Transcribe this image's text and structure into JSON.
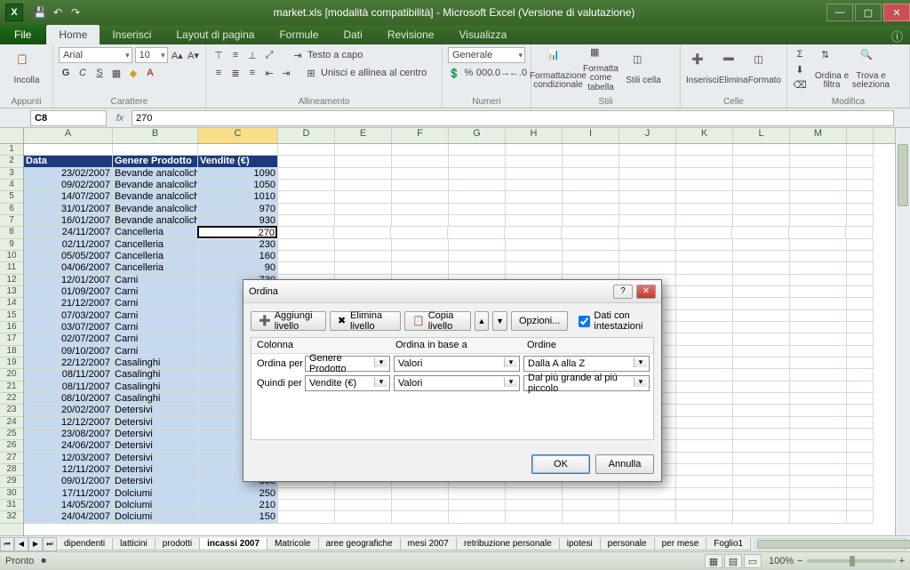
{
  "title": "market.xls  [modalità compatibilità] - Microsoft Excel (Versione di valutazione)",
  "tabs": {
    "file": "File",
    "items": [
      "Home",
      "Inserisci",
      "Layout di pagina",
      "Formule",
      "Dati",
      "Revisione",
      "Visualizza"
    ],
    "active": 0
  },
  "ribbon": {
    "clipboard": {
      "paste": "Incolla",
      "label": "Appunti"
    },
    "font": {
      "name": "Arial",
      "size": "10",
      "label": "Carattere"
    },
    "align": {
      "wrap": "Testo a capo",
      "merge": "Unisci e allinea al centro",
      "label": "Allineamento"
    },
    "number": {
      "fmt": "Generale",
      "label": "Numeri"
    },
    "styles": {
      "cond": "Formattazione condizionale",
      "tbl": "Formatta come tabella",
      "cell": "Stili cella",
      "label": "Stili"
    },
    "cells": {
      "ins": "Inserisci",
      "del": "Elimina",
      "fmt": "Formato",
      "label": "Celle"
    },
    "editing": {
      "sort": "Ordina e filtra",
      "find": "Trova e seleziona",
      "label": "Modifica"
    }
  },
  "namebox": "C8",
  "formula": "270",
  "columns": [
    "A",
    "B",
    "C",
    "D",
    "E",
    "F",
    "G",
    "H",
    "I",
    "J",
    "K",
    "L",
    "M",
    ""
  ],
  "activeCol": "C",
  "headers": {
    "a": "Data",
    "b": "Genere Prodotto",
    "c": "Vendite (€)"
  },
  "rows": [
    {
      "a": "23/02/2007",
      "b": "Bevande analcoliche",
      "c": "1090"
    },
    {
      "a": "09/02/2007",
      "b": "Bevande analcoliche",
      "c": "1050"
    },
    {
      "a": "14/07/2007",
      "b": "Bevande analcoliche",
      "c": "1010"
    },
    {
      "a": "31/01/2007",
      "b": "Bevande analcoliche",
      "c": "970"
    },
    {
      "a": "16/01/2007",
      "b": "Bevande analcoliche",
      "c": "930"
    },
    {
      "a": "24/11/2007",
      "b": "Cancelleria",
      "c": "270",
      "active": true
    },
    {
      "a": "02/11/2007",
      "b": "Cancelleria",
      "c": "230"
    },
    {
      "a": "05/05/2007",
      "b": "Cancelleria",
      "c": "160"
    },
    {
      "a": "04/06/2007",
      "b": "Cancelleria",
      "c": "90"
    },
    {
      "a": "12/01/2007",
      "b": "Carni",
      "c": "730"
    },
    {
      "a": "01/09/2007",
      "b": "Carni",
      "c": ""
    },
    {
      "a": "21/12/2007",
      "b": "Carni",
      "c": ""
    },
    {
      "a": "07/03/2007",
      "b": "Carni",
      "c": ""
    },
    {
      "a": "03/07/2007",
      "b": "Carni",
      "c": ""
    },
    {
      "a": "02/07/2007",
      "b": "Carni",
      "c": ""
    },
    {
      "a": "09/10/2007",
      "b": "Carni",
      "c": ""
    },
    {
      "a": "22/12/2007",
      "b": "Casalinghi",
      "c": ""
    },
    {
      "a": "08/11/2007",
      "b": "Casalinghi",
      "c": ""
    },
    {
      "a": "08/11/2007",
      "b": "Casalinghi",
      "c": ""
    },
    {
      "a": "08/10/2007",
      "b": "Casalinghi",
      "c": ""
    },
    {
      "a": "20/02/2007",
      "b": "Detersivi",
      "c": ""
    },
    {
      "a": "12/12/2007",
      "b": "Detersivi",
      "c": ""
    },
    {
      "a": "23/08/2007",
      "b": "Detersivi",
      "c": ""
    },
    {
      "a": "24/06/2007",
      "b": "Detersivi",
      "c": ""
    },
    {
      "a": "12/03/2007",
      "b": "Detersivi",
      "c": ""
    },
    {
      "a": "12/11/2007",
      "b": "Detersivi",
      "c": ""
    },
    {
      "a": "09/01/2007",
      "b": "Detersivi",
      "c": "380"
    },
    {
      "a": "17/11/2007",
      "b": "Dolciumi",
      "c": "250"
    },
    {
      "a": "14/05/2007",
      "b": "Dolciumi",
      "c": "210"
    },
    {
      "a": "24/04/2007",
      "b": "Dolciumi",
      "c": "150"
    }
  ],
  "sheets": {
    "nav": [
      "⏮",
      "◀",
      "▶",
      "⏭"
    ],
    "items": [
      "dipendenti",
      "latticini",
      "prodotti",
      "incassi 2007",
      "Matricole",
      "aree geografiche",
      "mesi 2007",
      "retribuzione personale",
      "ipotesi",
      "personale",
      "per mese",
      "Foglio1"
    ],
    "active": 3
  },
  "status": {
    "ready": "Pronto",
    "zoom": "100%"
  },
  "dialog": {
    "title": "Ordina",
    "addLevel": "Aggiungi livello",
    "delLevel": "Elimina livello",
    "copyLevel": "Copia livello",
    "options": "Opzioni...",
    "headers": "Dati con intestazioni",
    "cols": {
      "col": "Colonna",
      "sort": "Ordina in base a",
      "order": "Ordine"
    },
    "r1": {
      "lab": "Ordina per",
      "col": "Genere Prodotto",
      "sort": "Valori",
      "order": "Dalla A alla Z"
    },
    "r2": {
      "lab": "Quindi per",
      "col": "Vendite (€)",
      "sort": "Valori",
      "order": "Dal più grande al più piccolo"
    },
    "ok": "OK",
    "cancel": "Annulla"
  }
}
